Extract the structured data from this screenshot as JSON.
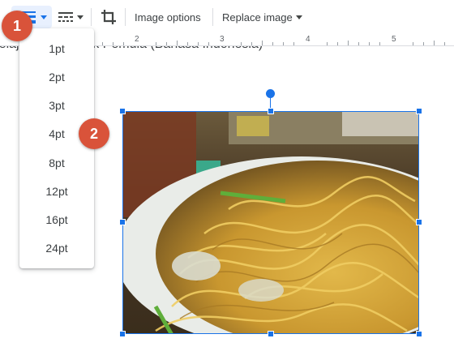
{
  "toolbar": {
    "image_options_label": "Image options",
    "replace_image_label": "Replace image"
  },
  "ruler": {
    "marks": [
      "2",
      "3",
      "4",
      "5"
    ]
  },
  "document": {
    "text_line": "Belajar Docs untuk Pemula (Bahasa Indonesia)"
  },
  "border_weight_menu": {
    "options": [
      "1pt",
      "2pt",
      "3pt",
      "4pt",
      "8pt",
      "12pt",
      "16pt",
      "24pt"
    ]
  },
  "steps": {
    "badge_1": "1",
    "badge_2": "2"
  },
  "colors": {
    "accent": "#1a73e8",
    "badge": "#d9533a",
    "selected_button_bg": "#e8f0fe"
  },
  "icons": [
    "border-weight-icon",
    "border-dash-icon",
    "crop-icon",
    "chevron-down-icon"
  ],
  "image": {
    "subject": "noodles"
  }
}
